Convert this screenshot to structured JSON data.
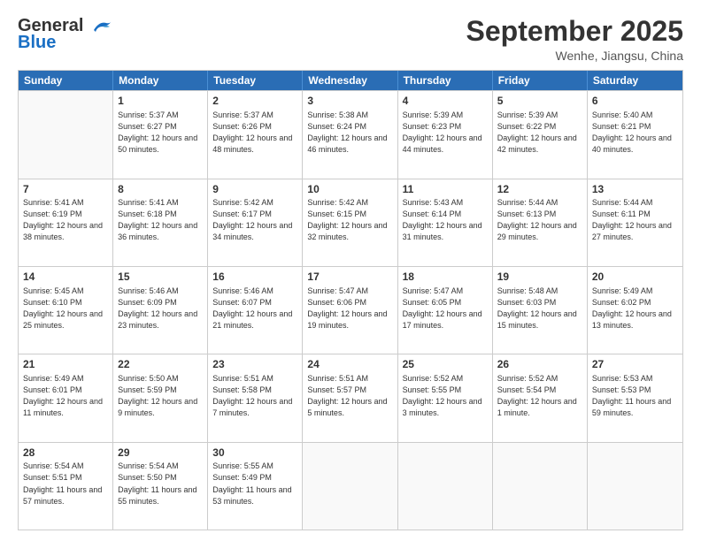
{
  "header": {
    "logo_line1": "General",
    "logo_line2": "Blue",
    "month": "September 2025",
    "location": "Wenhe, Jiangsu, China"
  },
  "days_of_week": [
    "Sunday",
    "Monday",
    "Tuesday",
    "Wednesday",
    "Thursday",
    "Friday",
    "Saturday"
  ],
  "weeks": [
    [
      {
        "day": "",
        "empty": true
      },
      {
        "day": "1",
        "sunrise": "Sunrise: 5:37 AM",
        "sunset": "Sunset: 6:27 PM",
        "daylight": "Daylight: 12 hours and 50 minutes."
      },
      {
        "day": "2",
        "sunrise": "Sunrise: 5:37 AM",
        "sunset": "Sunset: 6:26 PM",
        "daylight": "Daylight: 12 hours and 48 minutes."
      },
      {
        "day": "3",
        "sunrise": "Sunrise: 5:38 AM",
        "sunset": "Sunset: 6:24 PM",
        "daylight": "Daylight: 12 hours and 46 minutes."
      },
      {
        "day": "4",
        "sunrise": "Sunrise: 5:39 AM",
        "sunset": "Sunset: 6:23 PM",
        "daylight": "Daylight: 12 hours and 44 minutes."
      },
      {
        "day": "5",
        "sunrise": "Sunrise: 5:39 AM",
        "sunset": "Sunset: 6:22 PM",
        "daylight": "Daylight: 12 hours and 42 minutes."
      },
      {
        "day": "6",
        "sunrise": "Sunrise: 5:40 AM",
        "sunset": "Sunset: 6:21 PM",
        "daylight": "Daylight: 12 hours and 40 minutes."
      }
    ],
    [
      {
        "day": "7",
        "sunrise": "Sunrise: 5:41 AM",
        "sunset": "Sunset: 6:19 PM",
        "daylight": "Daylight: 12 hours and 38 minutes."
      },
      {
        "day": "8",
        "sunrise": "Sunrise: 5:41 AM",
        "sunset": "Sunset: 6:18 PM",
        "daylight": "Daylight: 12 hours and 36 minutes."
      },
      {
        "day": "9",
        "sunrise": "Sunrise: 5:42 AM",
        "sunset": "Sunset: 6:17 PM",
        "daylight": "Daylight: 12 hours and 34 minutes."
      },
      {
        "day": "10",
        "sunrise": "Sunrise: 5:42 AM",
        "sunset": "Sunset: 6:15 PM",
        "daylight": "Daylight: 12 hours and 32 minutes."
      },
      {
        "day": "11",
        "sunrise": "Sunrise: 5:43 AM",
        "sunset": "Sunset: 6:14 PM",
        "daylight": "Daylight: 12 hours and 31 minutes."
      },
      {
        "day": "12",
        "sunrise": "Sunrise: 5:44 AM",
        "sunset": "Sunset: 6:13 PM",
        "daylight": "Daylight: 12 hours and 29 minutes."
      },
      {
        "day": "13",
        "sunrise": "Sunrise: 5:44 AM",
        "sunset": "Sunset: 6:11 PM",
        "daylight": "Daylight: 12 hours and 27 minutes."
      }
    ],
    [
      {
        "day": "14",
        "sunrise": "Sunrise: 5:45 AM",
        "sunset": "Sunset: 6:10 PM",
        "daylight": "Daylight: 12 hours and 25 minutes."
      },
      {
        "day": "15",
        "sunrise": "Sunrise: 5:46 AM",
        "sunset": "Sunset: 6:09 PM",
        "daylight": "Daylight: 12 hours and 23 minutes."
      },
      {
        "day": "16",
        "sunrise": "Sunrise: 5:46 AM",
        "sunset": "Sunset: 6:07 PM",
        "daylight": "Daylight: 12 hours and 21 minutes."
      },
      {
        "day": "17",
        "sunrise": "Sunrise: 5:47 AM",
        "sunset": "Sunset: 6:06 PM",
        "daylight": "Daylight: 12 hours and 19 minutes."
      },
      {
        "day": "18",
        "sunrise": "Sunrise: 5:47 AM",
        "sunset": "Sunset: 6:05 PM",
        "daylight": "Daylight: 12 hours and 17 minutes."
      },
      {
        "day": "19",
        "sunrise": "Sunrise: 5:48 AM",
        "sunset": "Sunset: 6:03 PM",
        "daylight": "Daylight: 12 hours and 15 minutes."
      },
      {
        "day": "20",
        "sunrise": "Sunrise: 5:49 AM",
        "sunset": "Sunset: 6:02 PM",
        "daylight": "Daylight: 12 hours and 13 minutes."
      }
    ],
    [
      {
        "day": "21",
        "sunrise": "Sunrise: 5:49 AM",
        "sunset": "Sunset: 6:01 PM",
        "daylight": "Daylight: 12 hours and 11 minutes."
      },
      {
        "day": "22",
        "sunrise": "Sunrise: 5:50 AM",
        "sunset": "Sunset: 5:59 PM",
        "daylight": "Daylight: 12 hours and 9 minutes."
      },
      {
        "day": "23",
        "sunrise": "Sunrise: 5:51 AM",
        "sunset": "Sunset: 5:58 PM",
        "daylight": "Daylight: 12 hours and 7 minutes."
      },
      {
        "day": "24",
        "sunrise": "Sunrise: 5:51 AM",
        "sunset": "Sunset: 5:57 PM",
        "daylight": "Daylight: 12 hours and 5 minutes."
      },
      {
        "day": "25",
        "sunrise": "Sunrise: 5:52 AM",
        "sunset": "Sunset: 5:55 PM",
        "daylight": "Daylight: 12 hours and 3 minutes."
      },
      {
        "day": "26",
        "sunrise": "Sunrise: 5:52 AM",
        "sunset": "Sunset: 5:54 PM",
        "daylight": "Daylight: 12 hours and 1 minute."
      },
      {
        "day": "27",
        "sunrise": "Sunrise: 5:53 AM",
        "sunset": "Sunset: 5:53 PM",
        "daylight": "Daylight: 11 hours and 59 minutes."
      }
    ],
    [
      {
        "day": "28",
        "sunrise": "Sunrise: 5:54 AM",
        "sunset": "Sunset: 5:51 PM",
        "daylight": "Daylight: 11 hours and 57 minutes."
      },
      {
        "day": "29",
        "sunrise": "Sunrise: 5:54 AM",
        "sunset": "Sunset: 5:50 PM",
        "daylight": "Daylight: 11 hours and 55 minutes."
      },
      {
        "day": "30",
        "sunrise": "Sunrise: 5:55 AM",
        "sunset": "Sunset: 5:49 PM",
        "daylight": "Daylight: 11 hours and 53 minutes."
      },
      {
        "day": "",
        "empty": true
      },
      {
        "day": "",
        "empty": true
      },
      {
        "day": "",
        "empty": true
      },
      {
        "day": "",
        "empty": true
      }
    ]
  ]
}
